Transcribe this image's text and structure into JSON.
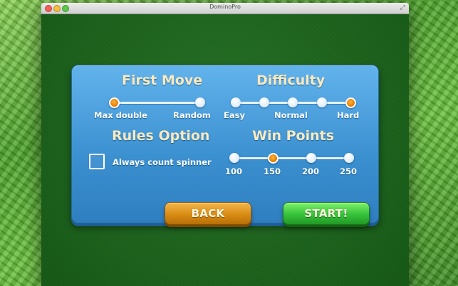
{
  "window": {
    "title": "DominoPro"
  },
  "first_move": {
    "heading": "First Move",
    "options": [
      "Max double",
      "Random"
    ],
    "selected": "Max double"
  },
  "difficulty": {
    "heading": "Difficulty",
    "options": [
      "Easy",
      "Normal",
      "Hard"
    ],
    "steps": 5,
    "selected": "Hard"
  },
  "rules_option": {
    "heading": "Rules Option",
    "checkbox_label": "Always count spinner",
    "checked": false
  },
  "win_points": {
    "heading": "Win Points",
    "options": [
      "100",
      "150",
      "200",
      "250"
    ],
    "selected": "150"
  },
  "buttons": {
    "back": "BACK",
    "start": "START!"
  },
  "colors": {
    "panel": "#3a8fcf",
    "heading_text": "#fbe9bf",
    "selected_dot": "#e07900",
    "back_button": "#d98c14",
    "start_button": "#36c23a",
    "felt": "#1b681b"
  },
  "icons": {
    "fullscreen": "fullscreen-icon"
  }
}
